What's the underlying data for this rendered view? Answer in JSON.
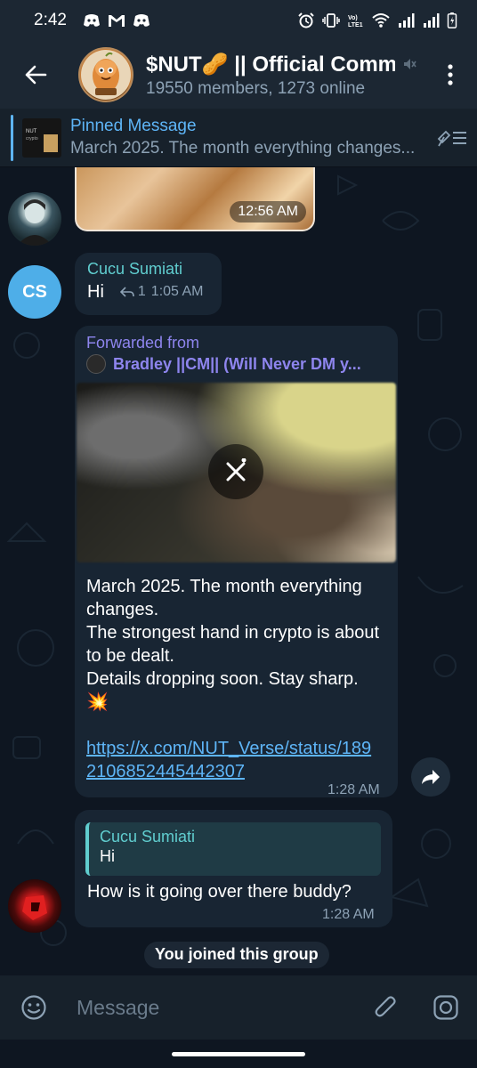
{
  "status_bar": {
    "time": "2:42",
    "left_icons": [
      "discord-icon",
      "gmail-icon",
      "discord-icon"
    ],
    "right_icons": [
      "alarm-icon",
      "vibrate-icon",
      "volte-icon",
      "wifi-icon",
      "signal-icon",
      "signal-icon",
      "battery-icon"
    ]
  },
  "header": {
    "title": "$NUT🥜 || Official Comm",
    "subtitle": "19550 members, 1273 online"
  },
  "pinned": {
    "title": "Pinned Message",
    "text": "March 2025. The month everything changes..."
  },
  "messages": {
    "image_time": "12:56 AM",
    "cucu": {
      "avatar_initials": "CS",
      "sender": "Cucu Sumiati",
      "text": "Hi",
      "reply_count": "1",
      "time": "1:05 AM"
    },
    "forwarded": {
      "label": "Forwarded from",
      "source": "Bradley ||CM|| (Will Never DM y...",
      "text_line1": "March 2025. The month everything changes.",
      "text_line2": "The strongest hand in crypto is about to be dealt.",
      "text_line3": "Details dropping soon. Stay sharp.",
      "emoji": "💥",
      "link": "https://x.com/NUT_Verse/status/1892106852445442307",
      "time": "1:28 AM"
    },
    "reply": {
      "quoted_sender": "Cucu Sumiati",
      "quoted_text": "Hi",
      "text": "How is it going over there buddy?",
      "time": "1:28 AM"
    },
    "service": "You joined this group"
  },
  "input": {
    "placeholder": "Message"
  },
  "colors": {
    "header_bg": "#1c2733",
    "chat_bg": "#0e1621",
    "bubble_bg": "#182533",
    "accent_blue": "#5eb5f7",
    "sender_teal": "#60cdcf",
    "forward_purple": "#8e85ee"
  }
}
